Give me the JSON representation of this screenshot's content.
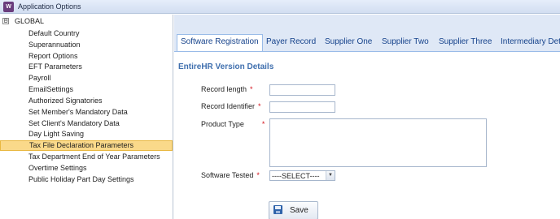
{
  "window": {
    "title": "Application Options",
    "icon": "app-options-icon"
  },
  "tree": {
    "root": {
      "label": "GLOBAL",
      "expander": "⊟"
    },
    "items": [
      {
        "label": "Default Country"
      },
      {
        "label": "Superannuation"
      },
      {
        "label": "Report Options"
      },
      {
        "label": "EFT Parameters"
      },
      {
        "label": "Payroll"
      },
      {
        "label": "EmailSettings"
      },
      {
        "label": "Authorized Signatories"
      },
      {
        "label": "Set Member's Mandatory Data"
      },
      {
        "label": "Set Client's Mandatory Data"
      },
      {
        "label": "Day Light Saving"
      },
      {
        "label": "Tax File Declaration Parameters",
        "selected": true
      },
      {
        "label": "Tax Department End of Year Parameters"
      },
      {
        "label": "Overtime Settings"
      },
      {
        "label": "Public Holiday Part Day Settings"
      }
    ]
  },
  "tabs": [
    {
      "label": "Software Registration",
      "active": true
    },
    {
      "label": "Payer Record"
    },
    {
      "label": "Supplier One"
    },
    {
      "label": "Supplier Two"
    },
    {
      "label": "Supplier Three"
    },
    {
      "label": "Intermediary Deta"
    }
  ],
  "form": {
    "section_title": "EntireHR Version Details",
    "required_mark": "*",
    "record_length": {
      "label": "Record length",
      "value": ""
    },
    "record_identifier": {
      "label": "Record Identifier",
      "value": ""
    },
    "product_type": {
      "label": "Product Type",
      "value": ""
    },
    "software_tested": {
      "label": "Software Tested",
      "selected": "----SELECT----",
      "arrow": "▼"
    },
    "save_label": "Save"
  },
  "colors": {
    "section_title": "#3f6fae",
    "tab_text": "#15428b",
    "selected_row": "#fad98a",
    "required": "#d4141e"
  }
}
